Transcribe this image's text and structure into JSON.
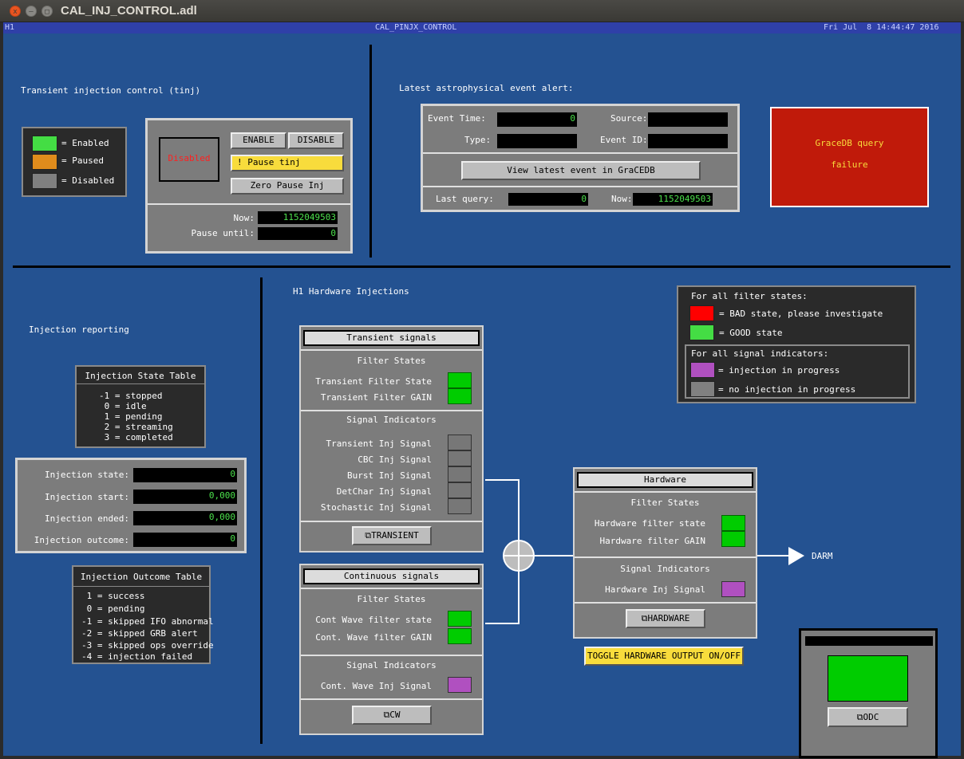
{
  "window": {
    "title": "CAL_INJ_CONTROL.adl",
    "close": "x",
    "minimize": "–",
    "maximize": "□"
  },
  "header": {
    "left": "H1",
    "center": "CAL_PINJX_CONTROL",
    "right": "Fri Jul  8 14:44:47 2016"
  },
  "tinj": {
    "title": "Transient injection control (tinj)",
    "legend": [
      {
        "label": "= Enabled",
        "color": "#44dd44"
      },
      {
        "label": "= Paused",
        "color": "#e08c1c"
      },
      {
        "label": "= Disabled",
        "color": "#808080"
      }
    ],
    "status": "Disabled",
    "enable": "ENABLE",
    "disable": "DISABLE",
    "pause": "! Pause tinj",
    "zero_pause": "Zero Pause Inj",
    "now_label": "Now:",
    "now_value": "1152049503",
    "pause_label": "Pause until:",
    "pause_value": "0"
  },
  "alert": {
    "title": "Latest astrophysical event alert:",
    "event_time_label": "Event Time:",
    "event_time_value": "0",
    "source_label": "Source:",
    "source_value": "",
    "type_label": "Type:",
    "type_value": "",
    "event_id_label": "Event ID:",
    "event_id_value": "",
    "view_button": "View latest event in GraCEDB",
    "last_query_label": "Last query:",
    "last_query_value": "0",
    "now_label": "Now:",
    "now_value": "1152049503",
    "gracedb_line1": "GraceDB query",
    "gracedb_line2": "failure"
  },
  "reporting": {
    "title": "Injection reporting",
    "state_table_title": "Injection State Table",
    "state_table": [
      "-1 = stopped",
      " 0 = idle",
      " 1 = pending",
      " 2 = streaming",
      " 3 = completed"
    ],
    "state_label": "Injection state:",
    "state_value": "0",
    "start_label": "Injection start:",
    "start_value": "0,000",
    "ended_label": "Injection ended:",
    "ended_value": "0,000",
    "outcome_label": "Injection outcome:",
    "outcome_value": "0",
    "outcome_table_title": "Injection Outcome Table",
    "outcome_table": [
      " 1 = success",
      " 0 = pending",
      "-1 = skipped IFO abnormal",
      "-2 = skipped GRB alert",
      "-3 = skipped ops override",
      "-4 = injection failed"
    ]
  },
  "hw": {
    "title": "H1 Hardware Injections",
    "legend_title": "For all filter states:",
    "bad": "= BAD state, please investigate",
    "good": "= GOOD state",
    "sig_title": "For all signal indicators:",
    "inprog": "= injection in progress",
    "noinj": "= no injection in progress",
    "transient": {
      "title": "Transient signals",
      "filter_states": "Filter States",
      "filters": [
        "Transient Filter State",
        "Transient Filter GAIN"
      ],
      "signal_indicators": "Signal Indicators",
      "signals": [
        "Transient Inj Signal",
        "CBC Inj Signal",
        "Burst Inj Signal",
        "DetChar Inj Signal",
        "Stochastic Inj Signal"
      ],
      "button": "TRANSIENT"
    },
    "continuous": {
      "title": "Continuous signals",
      "filter_states": "Filter States",
      "filters": [
        "Cont Wave filter state",
        "Cont. Wave filter GAIN"
      ],
      "signal_indicators": "Signal Indicators",
      "signals": [
        "Cont. Wave Inj Signal"
      ],
      "button": "CW"
    },
    "hardware": {
      "title": "Hardware",
      "filter_states": "Filter States",
      "filters": [
        "Hardware filter state",
        "Hardware filter GAIN"
      ],
      "signal_indicators": "Signal Indicators",
      "signals": [
        "Hardware Inj Signal"
      ],
      "button": "HARDWARE"
    },
    "toggle": "TOGGLE HARDWARE OUTPUT ON/OFF",
    "darm": "DARM",
    "odc": "ODC"
  },
  "colors": {
    "bg": "#245291",
    "bad": "#ff0000",
    "good": "#44dd44",
    "inprog": "#b050c0",
    "noinj": "#808080",
    "alert": "#c01a0a",
    "pause": "#f8dc3c"
  }
}
